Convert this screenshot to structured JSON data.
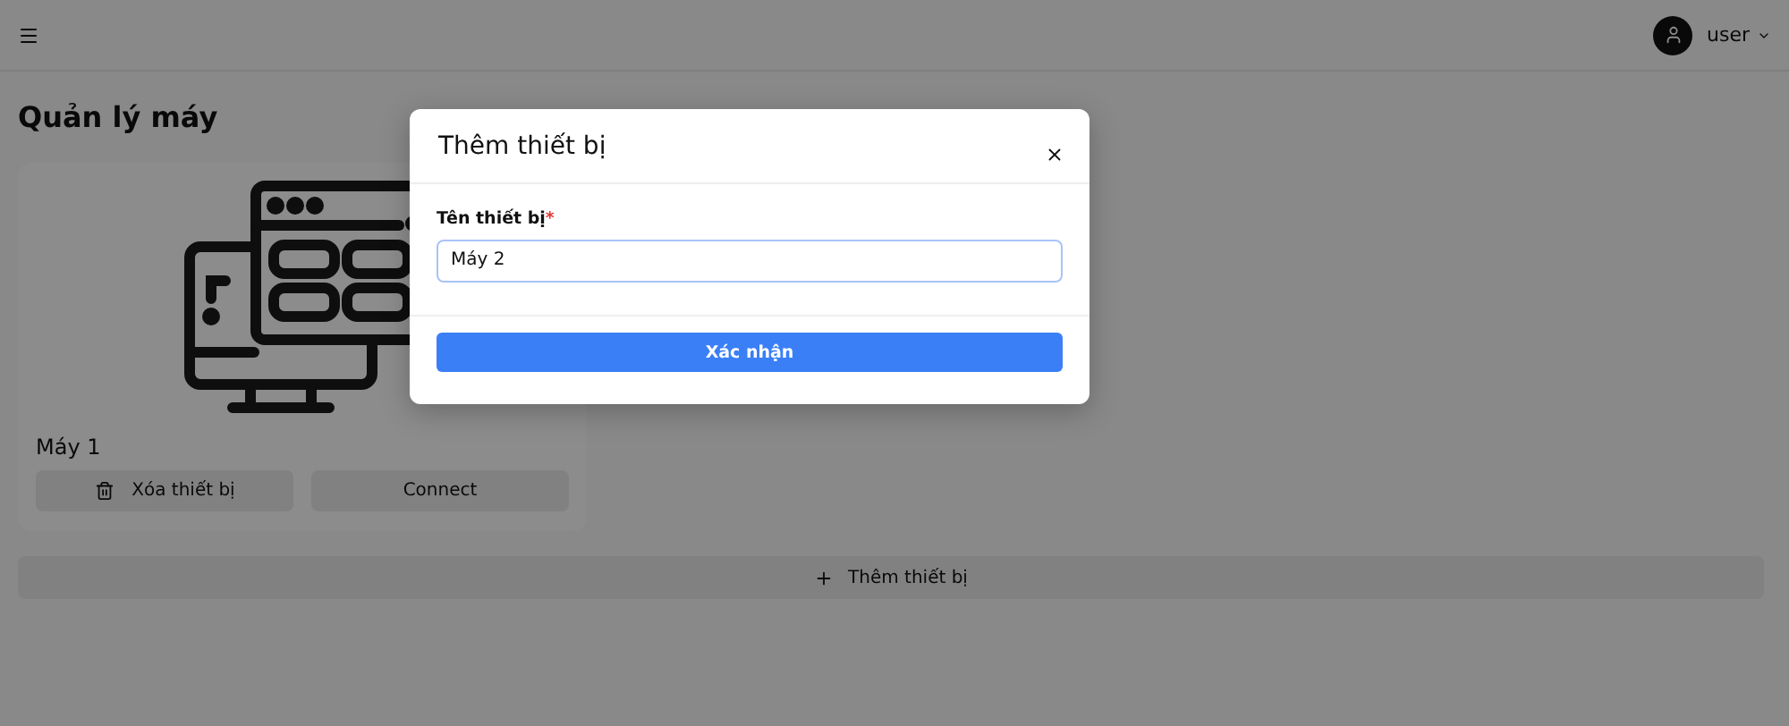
{
  "header": {
    "user": {
      "name": "user"
    }
  },
  "page": {
    "title": "Quản lý máy",
    "devices": [
      {
        "name": "Máy 1",
        "delete_label": "Xóa thiết bị",
        "connect_label": "Connect"
      }
    ],
    "add_button": "Thêm thiết bị"
  },
  "modal": {
    "title": "Thêm thiết bị",
    "field": {
      "label": "Tên thiết bị",
      "required_mark": "*",
      "value": "Máy 2"
    },
    "submit": "Xác nhận"
  }
}
